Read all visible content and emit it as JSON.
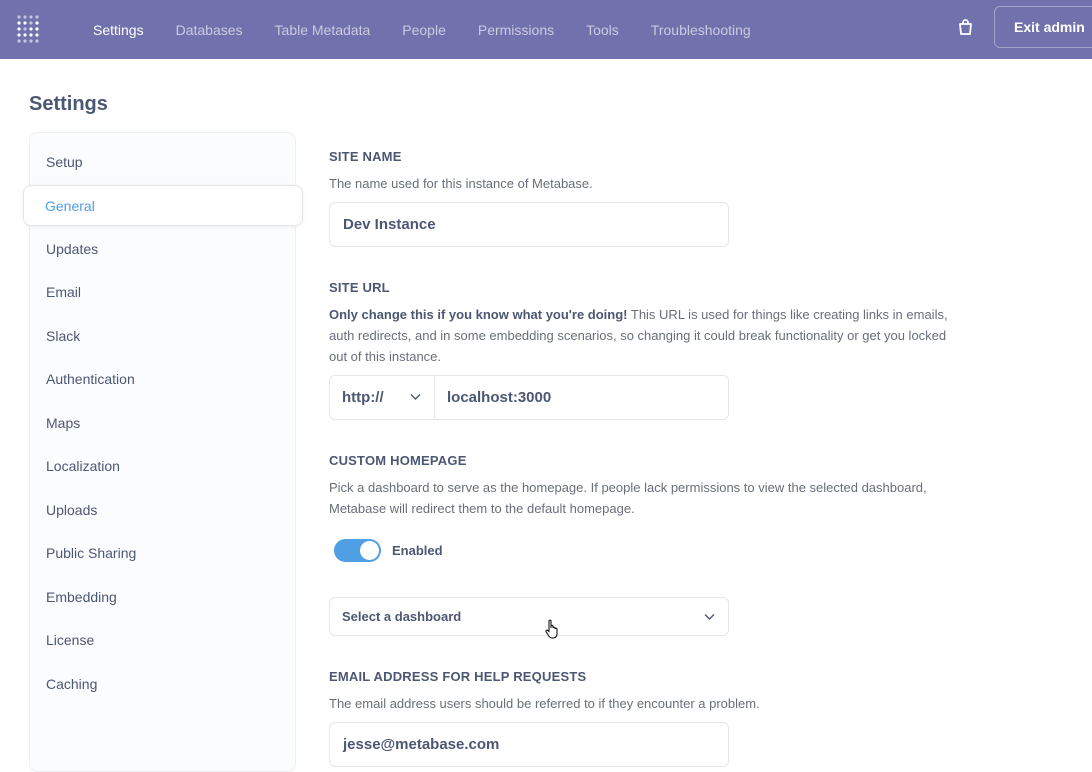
{
  "nav": {
    "items": [
      {
        "label": "Settings",
        "active": true
      },
      {
        "label": "Databases",
        "active": false
      },
      {
        "label": "Table Metadata",
        "active": false
      },
      {
        "label": "People",
        "active": false
      },
      {
        "label": "Permissions",
        "active": false
      },
      {
        "label": "Tools",
        "active": false
      },
      {
        "label": "Troubleshooting",
        "active": false
      }
    ],
    "exit_label": "Exit admin",
    "icons": {
      "logo": "metabase-logo",
      "store": "shopping-bag-icon"
    }
  },
  "page_title": "Settings",
  "sidebar": {
    "items": [
      {
        "label": "Setup"
      },
      {
        "label": "General",
        "active": true
      },
      {
        "label": "Updates"
      },
      {
        "label": "Email"
      },
      {
        "label": "Slack"
      },
      {
        "label": "Authentication"
      },
      {
        "label": "Maps"
      },
      {
        "label": "Localization"
      },
      {
        "label": "Uploads"
      },
      {
        "label": "Public Sharing"
      },
      {
        "label": "Embedding"
      },
      {
        "label": "License"
      },
      {
        "label": "Caching"
      }
    ]
  },
  "site_name": {
    "title": "SITE NAME",
    "description": "The name used for this instance of Metabase.",
    "value": "Dev Instance"
  },
  "site_url": {
    "title": "SITE URL",
    "warning": "Only change this if you know what you're doing!",
    "description": " This URL is used for things like creating links in emails, auth redirects, and in some embedding scenarios, so changing it could break functionality or get you locked out of this instance.",
    "protocol": "http://",
    "host": "localhost:3000"
  },
  "custom_homepage": {
    "title": "CUSTOM HOMEPAGE",
    "description": "Pick a dashboard to serve as the homepage. If people lack permissions to view the selected dashboard, Metabase will redirect them to the default homepage.",
    "toggle_label": "Enabled",
    "enabled": true,
    "select_placeholder": "Select a dashboard"
  },
  "help_email": {
    "title": "EMAIL ADDRESS FOR HELP REQUESTS",
    "description": "The email address users should be referred to if they encounter a problem.",
    "value": "jesse@metabase.com"
  },
  "colors": {
    "nav_bg": "#7172ad",
    "accent": "#509ee3",
    "text": "#4c5773"
  }
}
